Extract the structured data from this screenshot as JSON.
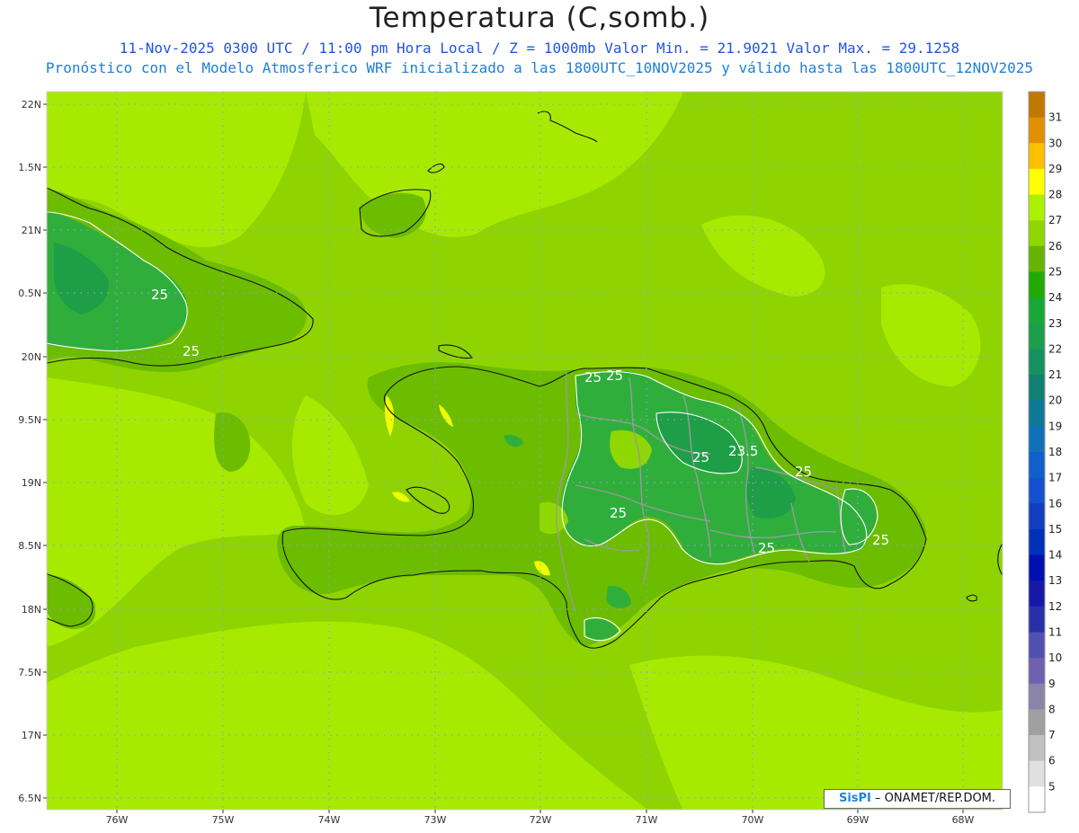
{
  "title": "Temperatura (C,somb.)",
  "subtitle_1": "11-Nov-2025 0300 UTC / 11:00 pm Hora Local / Z = 1000mb  Valor Min. = 21.9021  Valor Max. = 29.1258",
  "subtitle_2": "Pronóstico con el Modelo Atmosferico WRF inicializado a las 1800UTC_10NOV2025 y válido hasta las  1800UTC_12NOV2025",
  "credit": {
    "logo": "SisPI",
    "text": "– ONAMET/REP.DOM."
  },
  "colors": {
    "sea_base": "#8fd400",
    "warm_sea": "#aaee00",
    "land_cool": "#5cb000",
    "green_24": "#2eae2e",
    "green_23": "#1c9e3a",
    "hot_28": "#f0ff00",
    "grid_dots": "#9a9ad8",
    "coast": "#111111",
    "borders": "#999999"
  },
  "map": {
    "lat_labels": [
      "22N",
      "1.5N",
      "21N",
      "0.5N",
      "20N",
      "9.5N",
      "19N",
      "8.5N",
      "18N",
      "7.5N",
      "17N",
      "6.5N"
    ],
    "lon_labels": [
      "76W",
      "75W",
      "74W",
      "73W",
      "72W",
      "71W",
      "70W",
      "69W",
      "68W"
    ],
    "contour_labels": [
      "25",
      "25",
      "25",
      "25",
      "23.5",
      "25",
      "25",
      "25",
      "25",
      "25"
    ]
  },
  "colorbar": {
    "labels": [
      "31",
      "30",
      "29",
      "28",
      "27",
      "26",
      "25",
      "24",
      "23",
      "22",
      "21",
      "20",
      "19",
      "18",
      "17",
      "16",
      "15",
      "14",
      "13",
      "12",
      "11",
      "10",
      "9",
      "8",
      "7",
      "6",
      "5"
    ],
    "colors": [
      "#c07800",
      "#e09000",
      "#ffc000",
      "#ffff00",
      "#aaf000",
      "#8ed800",
      "#66b400",
      "#22aa00",
      "#18a838",
      "#1c9e4a",
      "#169060",
      "#108070",
      "#0e7898",
      "#1070b8",
      "#1060cc",
      "#1450d0",
      "#1040c0",
      "#0030b8",
      "#0010b0",
      "#1818a8",
      "#2830a8",
      "#5050b0",
      "#7060b0",
      "#8a84a8",
      "#a0a0a0",
      "#c0c0c0",
      "#e0e0e0",
      "#ffffff"
    ]
  }
}
